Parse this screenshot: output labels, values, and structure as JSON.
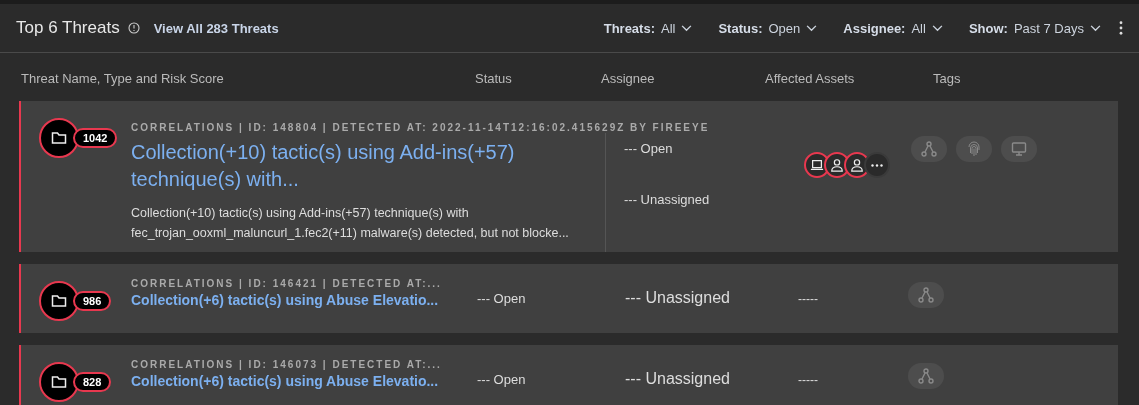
{
  "header": {
    "title": "Top 6 Threats",
    "view_all": "View All 283 Threats",
    "filters": [
      {
        "label": "Threats:",
        "value": "All"
      },
      {
        "label": "Status:",
        "value": "Open"
      },
      {
        "label": "Assignee:",
        "value": "All"
      },
      {
        "label": "Show:",
        "value": "Past 7 Days"
      }
    ]
  },
  "columns": [
    "Threat Name, Type and Risk Score",
    "Status",
    "Assignee",
    "Affected Assets",
    "Tags"
  ],
  "rows": [
    {
      "kind": "expanded",
      "score": "1042",
      "meta": "CORRELATIONS | ID: 148804 | DETECTED AT: 2022-11-14T12:16:02.415629Z BY FIREEYE",
      "title": "Collection(+10) tactic(s) using Add-ins(+57) technique(s) with...",
      "description": "Collection(+10) tactic(s) using Add-ins(+57) technique(s) with fec_trojan_ooxml_maluncurl_1.fec2(+11) malware(s) detected, but not blocke...",
      "status_summary": "--- Open",
      "assignee_summary": "--- Unassigned",
      "assets": [
        {
          "kind": "laptop"
        },
        {
          "kind": "user"
        },
        {
          "kind": "user"
        },
        {
          "kind": "more"
        }
      ],
      "tags": [
        {
          "kind": "graph"
        },
        {
          "kind": "fingerprint"
        },
        {
          "kind": "monitor"
        }
      ]
    },
    {
      "kind": "compact",
      "score": "986",
      "meta": "CORRELATIONS | ID: 146421 | DETECTED AT:...",
      "title": "Collection(+6) tactic(s) using Abuse Elevatio...",
      "status": "--- Open",
      "assignee": "--- Unassigned",
      "assets_text": "-----",
      "tags": [
        {
          "kind": "graph"
        }
      ]
    },
    {
      "kind": "compact",
      "score": "828",
      "meta": "CORRELATIONS | ID: 146073 | DETECTED AT:...",
      "title": "Collection(+6) tactic(s) using Abuse Elevatio...",
      "status": "--- Open",
      "assignee": "--- Unassigned",
      "assets_text": "-----",
      "tags": [
        {
          "kind": "graph"
        }
      ]
    }
  ]
}
